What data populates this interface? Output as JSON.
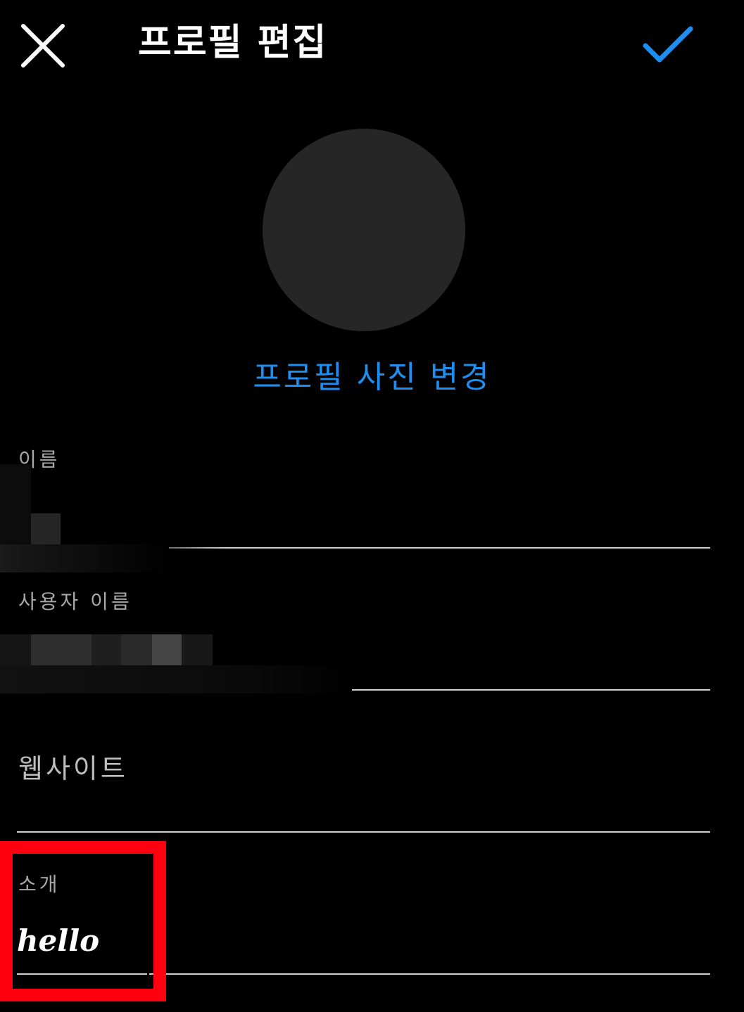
{
  "header": {
    "title": "프로필 편집",
    "close_icon": "close-icon",
    "confirm_icon": "check-icon",
    "confirm_color": "#1e8ff0"
  },
  "profile": {
    "change_photo_label": "프로필 사진 변경",
    "avatar_color": "#262626"
  },
  "fields": {
    "name": {
      "label": "이름",
      "value": ""
    },
    "username": {
      "label": "사용자 이름",
      "value": ""
    },
    "website": {
      "placeholder": "웹사이트",
      "value": ""
    },
    "bio": {
      "label": "소개",
      "value": "hello"
    }
  },
  "annotation": {
    "highlight_color": "#ff0010"
  }
}
